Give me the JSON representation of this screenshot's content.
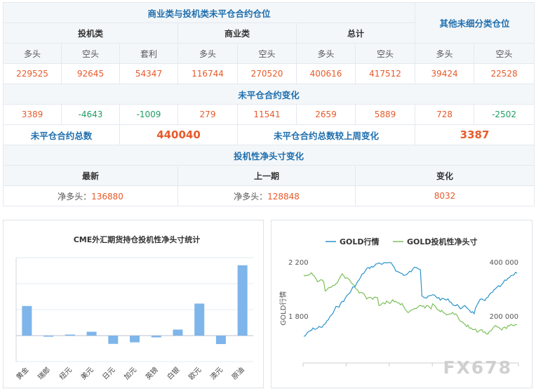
{
  "table": {
    "title": "商业类与投机类未平仓合约仓位",
    "other_title": "其他未细分类仓位",
    "groups": {
      "spec": "投机类",
      "comm": "商业类",
      "total": "总计"
    },
    "cols": {
      "long": "多头",
      "short": "空头",
      "spread": "套利"
    },
    "values": [
      "229525",
      "92645",
      "54347",
      "116744",
      "270520",
      "400616",
      "417512",
      "39424",
      "22528"
    ],
    "change_title": "未平仓合约变化",
    "changes": [
      "3389",
      "-4643",
      "-1009",
      "279",
      "11541",
      "2659",
      "5889",
      "728",
      "-2502"
    ],
    "total_label": "未平仓合约总数",
    "total_value": "440040",
    "week_change_label": "未平仓合约总数较上周变化",
    "week_change_value": "3387",
    "net_title": "投机性净头寸变化",
    "net_heads": {
      "latest": "最新",
      "previous": "上一期",
      "change": "变化"
    },
    "net_prefix": "净多头：",
    "net_latest": "136880",
    "net_previous": "128848",
    "net_change": "8032",
    "colors": {
      "red": "#e85a2a",
      "green": "#1e9c63",
      "blue": "#1f6fae",
      "bar": "#7eb5ea"
    }
  },
  "chart_data": [
    {
      "type": "bar",
      "title": "CME外汇期货持仓投机性净头寸统计",
      "categories": [
        "黄金",
        "瑞郎",
        "纽元",
        "美元",
        "日元",
        "加元",
        "英镑",
        "白银",
        "欧元",
        "澳元",
        "原油"
      ],
      "values": [
        136880,
        -3500,
        5000,
        18000,
        -38000,
        -31000,
        -8000,
        28000,
        148000,
        -39000,
        325000
      ],
      "ylim": [
        -120000,
        360000
      ],
      "grid": true
    },
    {
      "type": "line",
      "legend_position": "top",
      "series": [
        {
          "name": "GOLD行情",
          "color": "#2b93c8"
        },
        {
          "name": "GOLD投机性净头寸",
          "color": "#7cc05a"
        }
      ],
      "y_left_ticks": [
        "2 200",
        "1 800"
      ],
      "y_left_label": "GOLD行情",
      "y_right_ticks": [
        "400 000",
        "200 000"
      ]
    }
  ],
  "watermark": "FX678"
}
